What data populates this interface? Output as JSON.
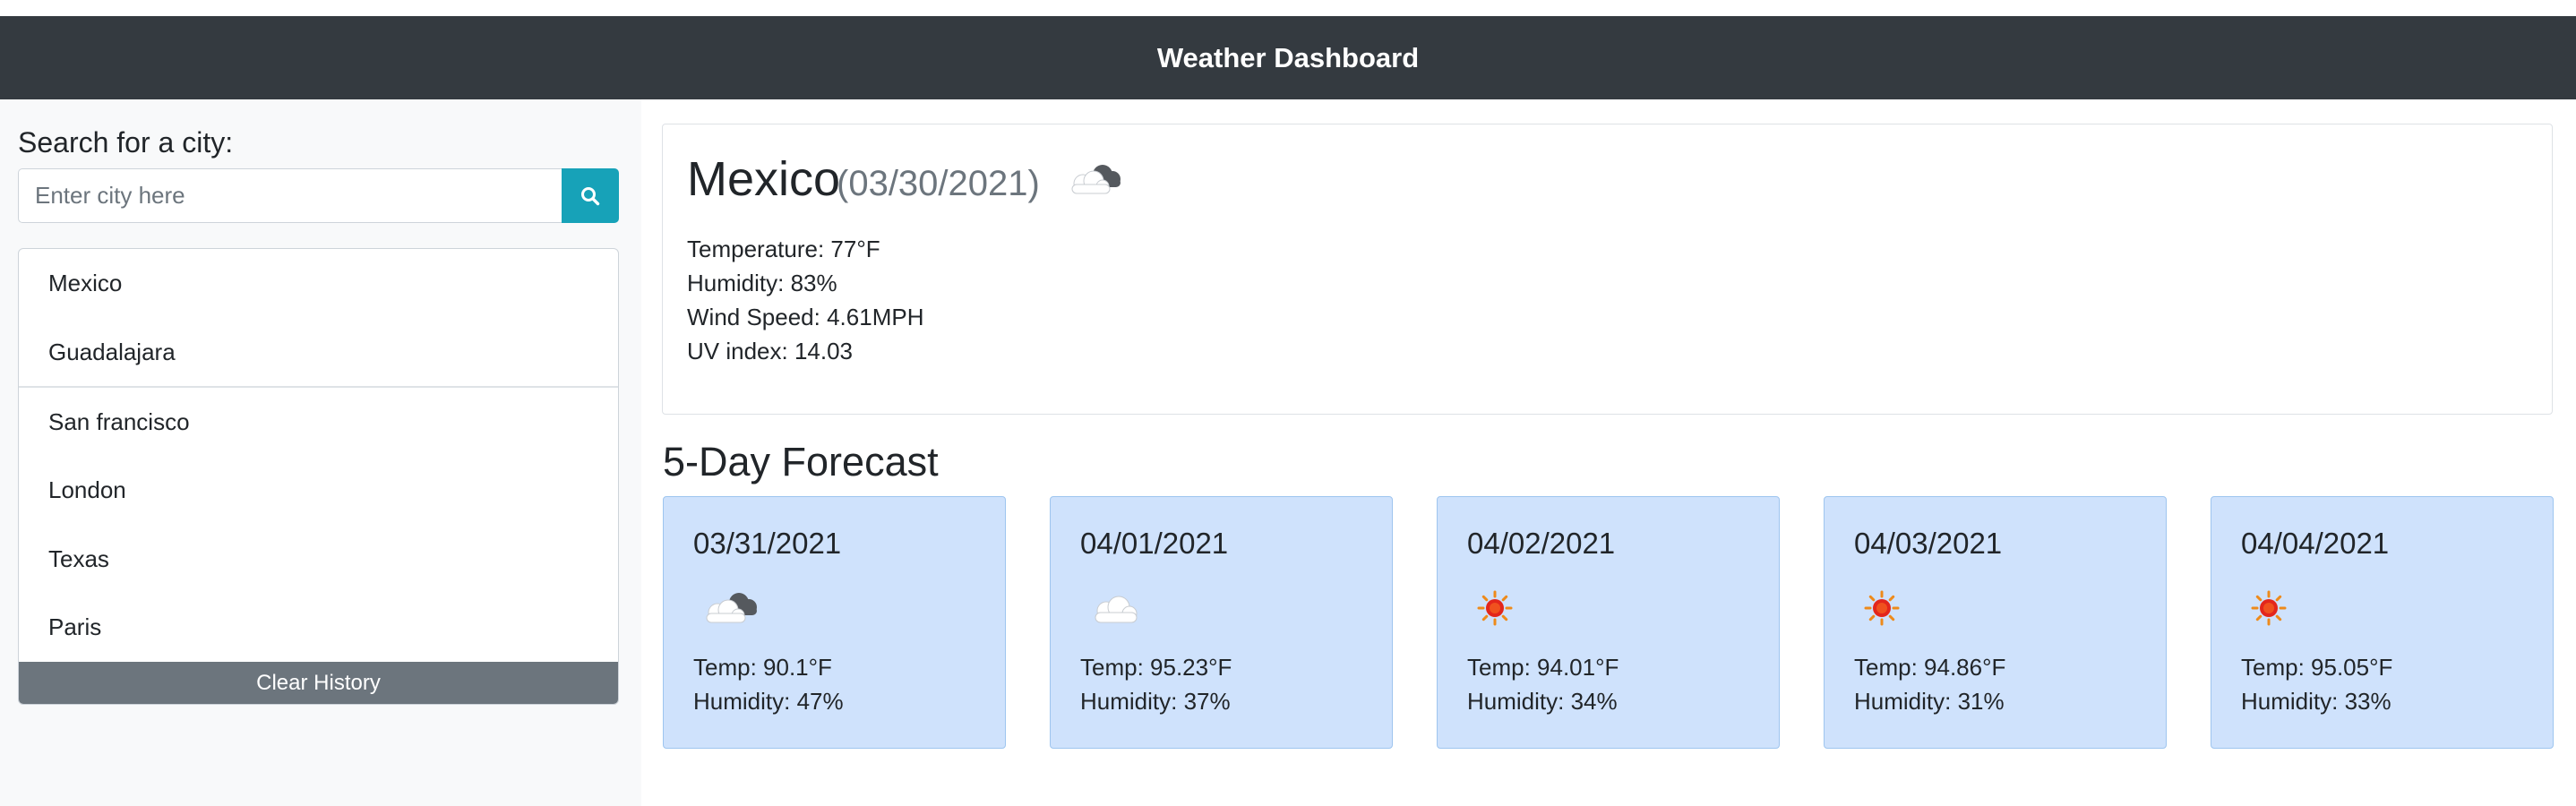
{
  "header": {
    "title": "Weather Dashboard"
  },
  "search": {
    "label": "Search for a city:",
    "placeholder": "Enter city here",
    "button_icon": "search-icon"
  },
  "history": {
    "items": [
      {
        "label": "Mexico"
      },
      {
        "label": "Guadalajara"
      },
      {
        "label": "San francisco"
      },
      {
        "label": "London"
      },
      {
        "label": "Texas"
      },
      {
        "label": "Paris"
      }
    ],
    "clear_label": "Clear History"
  },
  "current": {
    "city": "Mexico",
    "date": "(03/30/2021)",
    "icon": "partly-cloudy-icon",
    "temperature": "Temperature: 77°F",
    "humidity": "Humidity: 83%",
    "wind": "Wind Speed: 4.61MPH",
    "uv": "UV index: 14.03"
  },
  "forecast": {
    "title": "5-Day Forecast",
    "days": [
      {
        "date": "03/31/2021",
        "icon": "partly-cloudy-icon",
        "temp": "Temp: 90.1°F",
        "humidity": "Humidity: 47%"
      },
      {
        "date": "04/01/2021",
        "icon": "cloud-icon",
        "temp": "Temp: 95.23°F",
        "humidity": "Humidity: 37%"
      },
      {
        "date": "04/02/2021",
        "icon": "sun-icon",
        "temp": "Temp: 94.01°F",
        "humidity": "Humidity: 34%"
      },
      {
        "date": "04/03/2021",
        "icon": "sun-icon",
        "temp": "Temp: 94.86°F",
        "humidity": "Humidity: 31%"
      },
      {
        "date": "04/04/2021",
        "icon": "sun-icon",
        "temp": "Temp: 95.05°F",
        "humidity": "Humidity: 33%"
      }
    ]
  },
  "colors": {
    "navbar": "#343a40",
    "search_button": "#17a2b8",
    "clear_button": "#6c757d",
    "card_background": "#cfe2fc",
    "sidebar_background": "#f8f9fa"
  }
}
